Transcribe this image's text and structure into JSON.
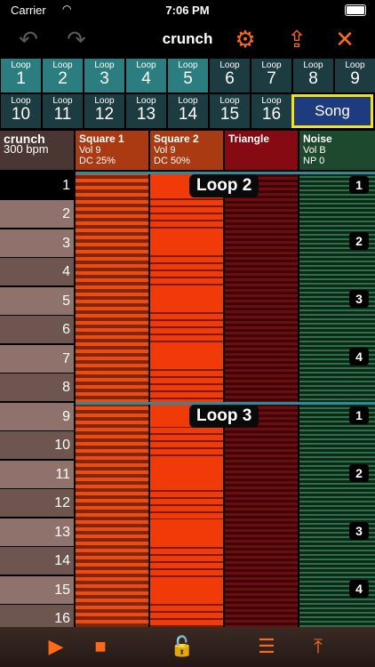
{
  "status": {
    "carrier": "Carrier",
    "time": "7:06 PM"
  },
  "toolbar": {
    "title": "crunch"
  },
  "loops": {
    "label": "Loop",
    "row1": [
      "1",
      "2",
      "3",
      "4",
      "5",
      "6",
      "7",
      "8",
      "9"
    ],
    "row2": [
      "10",
      "11",
      "12",
      "13",
      "14",
      "15",
      "16"
    ],
    "song": "Song"
  },
  "song_info": {
    "name": "crunch",
    "tempo": "300 bpm"
  },
  "channels": [
    {
      "name": "Square 1",
      "line1": "Vol 9",
      "line2": "DC 25%"
    },
    {
      "name": "Square 2",
      "line1": "Vol 9",
      "line2": "DC 50%"
    },
    {
      "name": "Triangle",
      "line1": "",
      "line2": ""
    },
    {
      "name": "Noise",
      "line1": "Vol B",
      "line2": "NP 0"
    }
  ],
  "rows": [
    "1",
    "2",
    "3",
    "4",
    "5",
    "6",
    "7",
    "8",
    "9",
    "10",
    "11",
    "12",
    "13",
    "14",
    "15",
    "16"
  ],
  "pattern": {
    "loop_a": "Loop 2",
    "loop_b": "Loop 3",
    "bars": [
      "1",
      "2",
      "3",
      "4",
      "1",
      "2",
      "3",
      "4"
    ]
  },
  "colors": {
    "accent": "#ff6a1a",
    "song_border": "#f0e21d"
  }
}
